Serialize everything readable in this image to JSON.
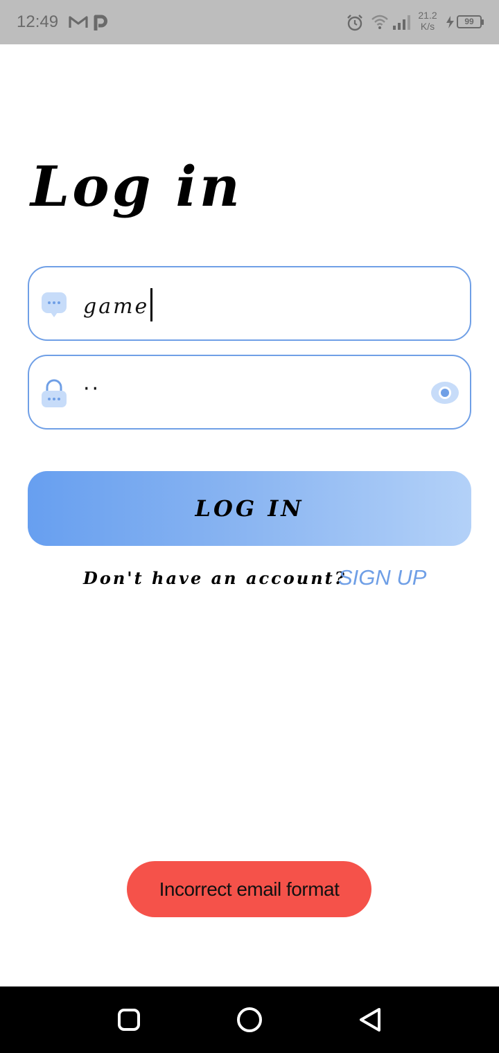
{
  "status_bar": {
    "time": "12:49",
    "net_speed_value": "21.2",
    "net_speed_unit": "K/s",
    "battery": "99"
  },
  "page": {
    "title": "Log in"
  },
  "email_field": {
    "value": "game",
    "icon": "message-icon"
  },
  "password_field": {
    "value": "··",
    "icon": "lock-icon",
    "toggle_icon": "eye-icon"
  },
  "login_button": {
    "label": "LOG IN"
  },
  "signup": {
    "prompt": "Don't have an account?",
    "link": "SIGN UP"
  },
  "toast": {
    "message": "Incorrect email format"
  },
  "colors": {
    "accent": "#6f9fe6",
    "toast": "#f5524a"
  }
}
